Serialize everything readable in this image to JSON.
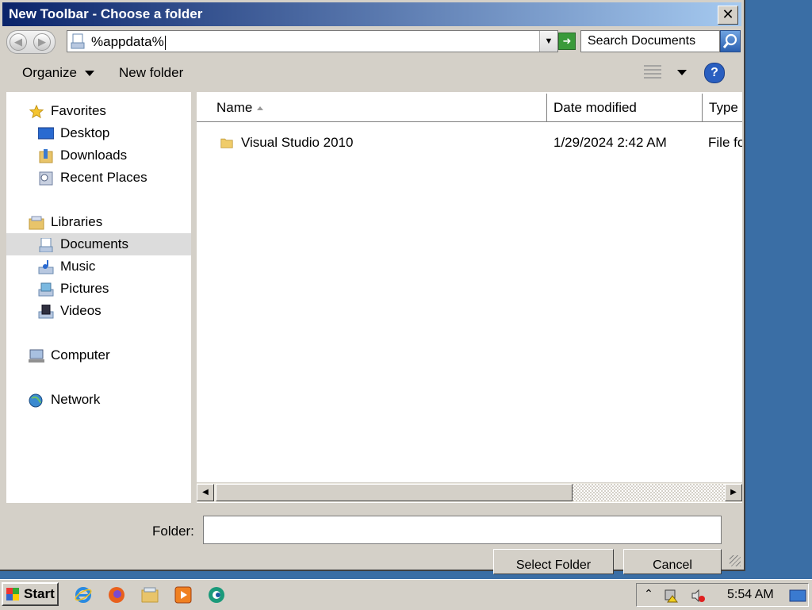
{
  "dialog": {
    "title": "New Toolbar - Choose a folder",
    "close_glyph": "✕"
  },
  "address": {
    "value": "%appdata%",
    "go_glyph": "➜"
  },
  "search": {
    "placeholder": "Search Documents"
  },
  "toolbar": {
    "organize_label": "Organize",
    "new_folder_label": "New folder",
    "help_glyph": "?"
  },
  "nav": {
    "favorites": "Favorites",
    "desktop": "Desktop",
    "downloads": "Downloads",
    "recent_places": "Recent Places",
    "libraries": "Libraries",
    "documents": "Documents",
    "music": "Music",
    "pictures": "Pictures",
    "videos": "Videos",
    "computer": "Computer",
    "network": "Network"
  },
  "columns": {
    "name": "Name",
    "date_modified": "Date modified",
    "type": "Type"
  },
  "files": [
    {
      "name": "Visual Studio 2010",
      "date_modified": "1/29/2024 2:42 AM",
      "type": "File fo"
    }
  ],
  "footer": {
    "folder_label": "Folder:",
    "folder_value": "",
    "select_button": "Select Folder",
    "cancel_button": "Cancel"
  },
  "taskbar": {
    "start_label": "Start",
    "clock": "5:54 AM",
    "tray_expand_glyph": "⌃"
  },
  "icons": [
    "folder-icon",
    "search-icon",
    "help-icon",
    "star-icon",
    "desktop-icon",
    "downloads-icon",
    "recent-places-icon",
    "libraries-icon",
    "documents-icon",
    "music-icon",
    "pictures-icon",
    "videos-icon",
    "computer-icon",
    "network-icon",
    "ie-icon",
    "firefox-icon",
    "explorer-icon",
    "media-player-icon",
    "app-icon",
    "volume-muted-icon",
    "network-status-icon",
    "show-desktop-icon"
  ],
  "colors": {
    "title_gradient_start": "#0a246a",
    "title_gradient_end": "#a6caf0",
    "desktop": "#3a6ea5",
    "selection": "#dcdcdc"
  }
}
